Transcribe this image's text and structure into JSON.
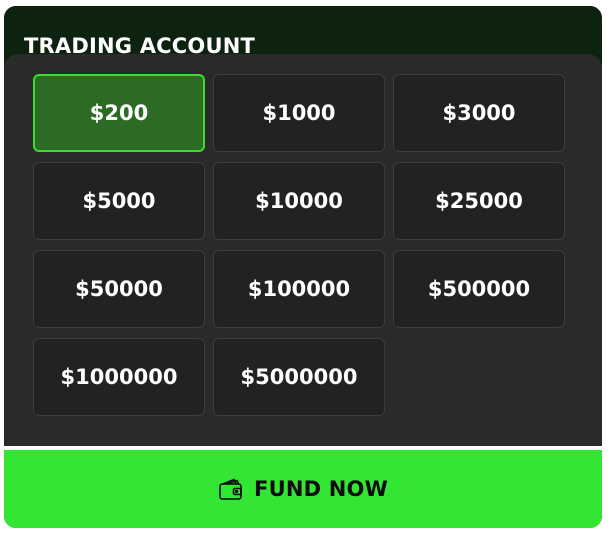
{
  "header": {
    "title": "TRADING ACCOUNT"
  },
  "amounts": [
    {
      "label": "$200",
      "selected": true
    },
    {
      "label": "$1000",
      "selected": false
    },
    {
      "label": "$3000",
      "selected": false
    },
    {
      "label": "$5000",
      "selected": false
    },
    {
      "label": "$10000",
      "selected": false
    },
    {
      "label": "$25000",
      "selected": false
    },
    {
      "label": "$50000",
      "selected": false
    },
    {
      "label": "$100000",
      "selected": false
    },
    {
      "label": "$500000",
      "selected": false
    },
    {
      "label": "$1000000",
      "selected": false
    },
    {
      "label": "$5000000",
      "selected": false
    }
  ],
  "fund_button": {
    "label": "FUND NOW",
    "icon": "wallet-icon"
  },
  "colors": {
    "accent": "#33e633",
    "selected_fill": "#2b6b24",
    "selected_border": "#3bdc2d",
    "panel": "#2a2a2a",
    "header": "#0e2210"
  }
}
